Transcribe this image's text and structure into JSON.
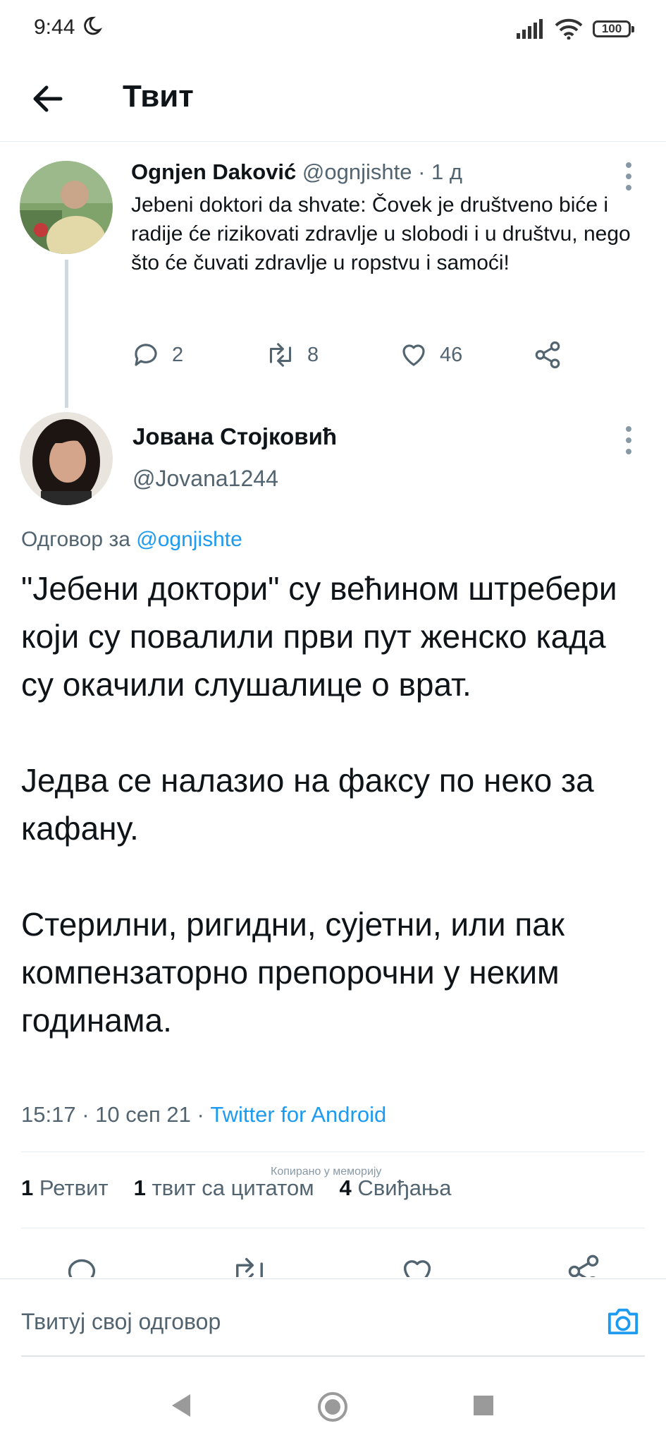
{
  "status_bar": {
    "time": "9:44",
    "battery": "100"
  },
  "header": {
    "title": "Твит"
  },
  "parent_tweet": {
    "author_name": "Ognjen Daković",
    "handle_time": "@ognjishte · 1 д",
    "text": "Jebeni doktori da shvate: Čovek je društveno biće i radije će rizikovati zdravlje u slobodi i u društvu, nego što će čuvati zdravlje u ropstvu i samoći!",
    "replies": "2",
    "retweets": "8",
    "likes": "46"
  },
  "main_tweet": {
    "author_name": "Јована Стојковић",
    "handle": "@Jovana1244",
    "reply_prefix": "Одговор за",
    "reply_to": "@ognjishte",
    "text": "\"Јебени доктори\" су већином штребери који су повалили први пут женско када су окачили слушалице о врат.\n\nЈедва се налазио на факсу по неко за кафану.\n\nСтерилни, ригидни, сујетни, или пак компензаторно препорочни у неким годинама.",
    "timestamp": "15:17 · 10 сеп 21 · ",
    "source": "Twitter for Android",
    "retweet_count": "1",
    "retweet_label": "Ретвит",
    "quote_count": "1",
    "quote_label": "твит са цитатом",
    "like_count": "4",
    "like_label": "Свиђања"
  },
  "toast": "Копирано у меморију",
  "compose": {
    "placeholder": "Твитуј свој одговор"
  },
  "colors": {
    "accent": "#1d9bf0",
    "muted": "#536471",
    "text": "#0f1419"
  }
}
